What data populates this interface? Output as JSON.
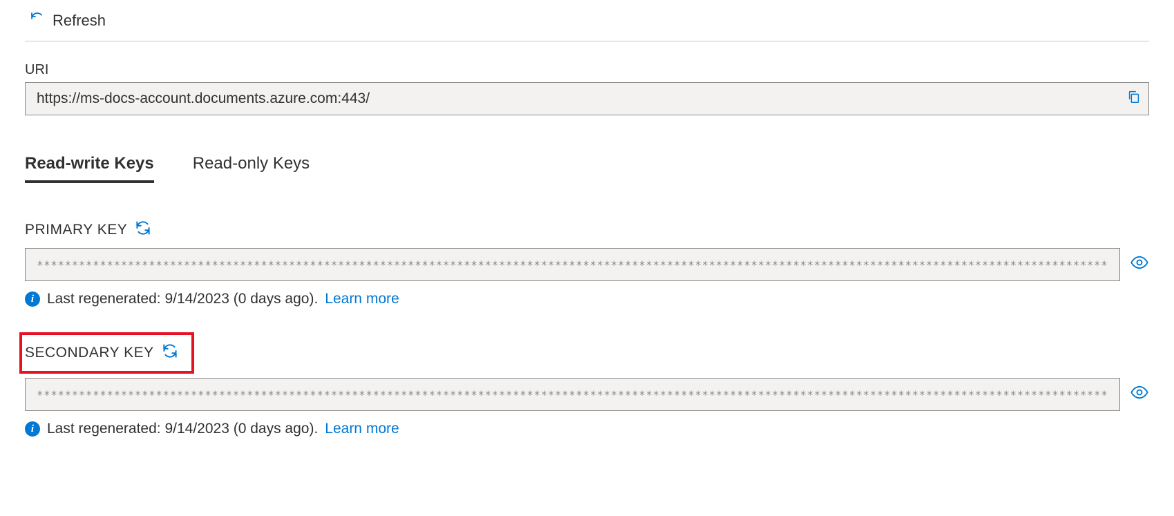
{
  "toolbar": {
    "refresh_label": "Refresh"
  },
  "uri": {
    "label": "URI",
    "value": "https://ms-docs-account.documents.azure.com:443/"
  },
  "tabs": {
    "read_write": "Read-write Keys",
    "read_only": "Read-only Keys"
  },
  "primary": {
    "label": "PRIMARY KEY",
    "masked_value": "************************************************************************************************************************************************************************",
    "info_text": "Last regenerated: 9/14/2023 (0 days ago). ",
    "learn_more": "Learn more"
  },
  "secondary": {
    "label": "SECONDARY KEY",
    "masked_value": "************************************************************************************************************************************************************************",
    "info_text": "Last regenerated: 9/14/2023 (0 days ago). ",
    "learn_more": "Learn more"
  }
}
